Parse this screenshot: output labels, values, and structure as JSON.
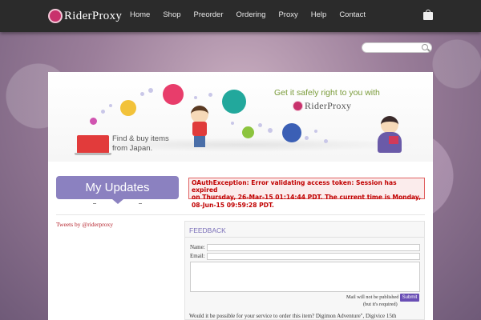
{
  "header": {
    "logo_text": "RiderProxy",
    "nav": [
      "Home",
      "Shop",
      "Preorder",
      "Ordering",
      "Proxy",
      "Help",
      "Contact"
    ]
  },
  "search": {
    "placeholder": ""
  },
  "banner": {
    "find_line1": "Find & buy items",
    "find_line2": "from Japan.",
    "tagline": "Get it safely right to you with",
    "logo_text": "RiderProxy"
  },
  "updates": {
    "title": "My Updates"
  },
  "error": {
    "line1": "OAuthException: Error validating access token: Session has expired",
    "line2": "on Thursday, 26-Mar-15 01:14:44 PDT. The current time is Monday,",
    "line3": "08-Jun-15 09:59:28 PDT."
  },
  "tweets": {
    "link": "Tweets by @riderproxy"
  },
  "feedback": {
    "title": "FEEDBACK",
    "name_label": "Name:",
    "email_label": "Email:",
    "note1": "Mail will not be published",
    "note2": "(but it's required)",
    "submit": "Submit",
    "message": "Would it be possible for your service to order this item? Digimon Adventure\", Digivice 15th"
  },
  "colors": {
    "accent": "#8b81c0",
    "error_red": "#c00000",
    "navbar": "#2b2b2b"
  }
}
